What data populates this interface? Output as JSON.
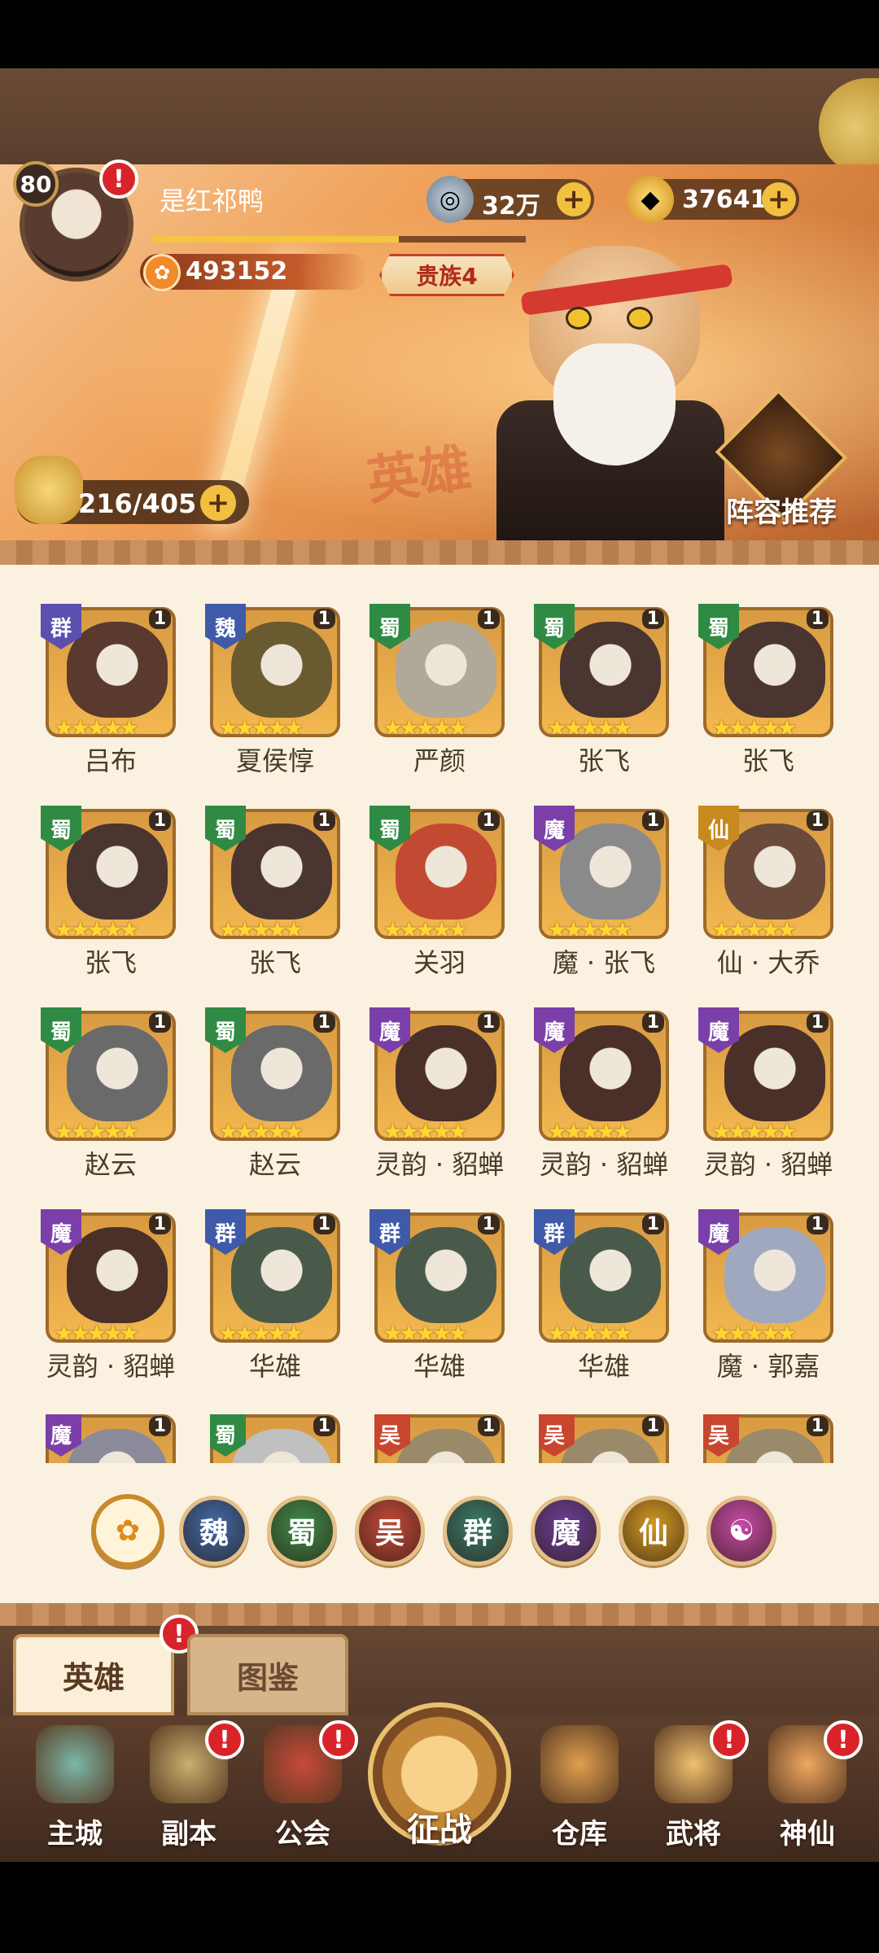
{
  "player": {
    "level": "80",
    "name": "是红祁鸭",
    "power": "493152",
    "vip": "贵族4",
    "exp_fraction": 0.66
  },
  "currencies": [
    {
      "name": "copper-coin",
      "value": "32万",
      "icon": "coin-icon"
    },
    {
      "name": "gold-ingot",
      "value": "37641",
      "icon": "ingot-icon"
    }
  ],
  "stamina": {
    "value": "216/405"
  },
  "banner": {
    "watermark": "英雄",
    "lineup_label": "阵容推荐"
  },
  "alert_glyph": "!",
  "plus_glyph": "+",
  "heroes": [
    {
      "faction": "群",
      "tier": "1",
      "name": "吕布",
      "color": "#5b4fb0"
    },
    {
      "faction": "魏",
      "tier": "1",
      "name": "夏侯惇",
      "color": "#3f5aa8"
    },
    {
      "faction": "蜀",
      "tier": "1",
      "name": "严颜",
      "color": "#2f8a44"
    },
    {
      "faction": "蜀",
      "tier": "1",
      "name": "张飞",
      "color": "#2f8a44"
    },
    {
      "faction": "蜀",
      "tier": "1",
      "name": "张飞",
      "color": "#2f8a44"
    },
    {
      "faction": "蜀",
      "tier": "1",
      "name": "张飞",
      "color": "#2f8a44"
    },
    {
      "faction": "蜀",
      "tier": "1",
      "name": "张飞",
      "color": "#2f8a44"
    },
    {
      "faction": "蜀",
      "tier": "1",
      "name": "关羽",
      "color": "#2f8a44"
    },
    {
      "faction": "魔",
      "tier": "1",
      "name": "魔 · 张飞",
      "color": "#7a3fa8"
    },
    {
      "faction": "仙",
      "tier": "1",
      "name": "仙 · 大乔",
      "color": "#c78a1e"
    },
    {
      "faction": "蜀",
      "tier": "1",
      "name": "赵云",
      "color": "#2f8a44"
    },
    {
      "faction": "蜀",
      "tier": "1",
      "name": "赵云",
      "color": "#2f8a44"
    },
    {
      "faction": "魔",
      "tier": "1",
      "name": "灵韵 · 貂蝉",
      "color": "#7a3fa8"
    },
    {
      "faction": "魔",
      "tier": "1",
      "name": "灵韵 · 貂蝉",
      "color": "#7a3fa8"
    },
    {
      "faction": "魔",
      "tier": "1",
      "name": "灵韵 · 貂蝉",
      "color": "#7a3fa8"
    },
    {
      "faction": "魔",
      "tier": "1",
      "name": "灵韵 · 貂蝉",
      "color": "#7a3fa8"
    },
    {
      "faction": "群",
      "tier": "1",
      "name": "华雄",
      "color": "#3f5aa8"
    },
    {
      "faction": "群",
      "tier": "1",
      "name": "华雄",
      "color": "#3f5aa8"
    },
    {
      "faction": "群",
      "tier": "1",
      "name": "华雄",
      "color": "#3f5aa8"
    },
    {
      "faction": "魔",
      "tier": "1",
      "name": "魔 · 郭嘉",
      "color": "#7a3fa8"
    },
    {
      "faction": "魔",
      "tier": "1",
      "name": "",
      "color": "#7a3fa8"
    },
    {
      "faction": "蜀",
      "tier": "1",
      "name": "",
      "color": "#2f8a44"
    },
    {
      "faction": "吴",
      "tier": "1",
      "name": "",
      "color": "#c8452e"
    },
    {
      "faction": "吴",
      "tier": "1",
      "name": "",
      "color": "#c8452e"
    },
    {
      "faction": "吴",
      "tier": "1",
      "name": "",
      "color": "#c8452e"
    }
  ],
  "filters": [
    {
      "label": "",
      "name": "all",
      "color": "#f2b33a",
      "icon": "paw-icon"
    },
    {
      "label": "魏",
      "name": "wei",
      "color": "#3f6aa8"
    },
    {
      "label": "蜀",
      "name": "shu",
      "color": "#3f8a4a"
    },
    {
      "label": "吴",
      "name": "wu",
      "color": "#c24a3a"
    },
    {
      "label": "群",
      "name": "qun",
      "color": "#3a7a6a"
    },
    {
      "label": "魔",
      "name": "mo",
      "color": "#6a3f98"
    },
    {
      "label": "仙",
      "name": "xian",
      "color": "#d29a24"
    },
    {
      "label": "",
      "name": "special",
      "color": "#c84aa8",
      "icon": "swirl-icon"
    }
  ],
  "tabs": [
    {
      "label": "英雄",
      "active": true
    },
    {
      "label": "图鉴",
      "active": false
    }
  ],
  "nav": [
    {
      "label": "主城",
      "alert": false
    },
    {
      "label": "副本",
      "alert": true
    },
    {
      "label": "公会",
      "alert": true
    },
    {
      "label": "征战",
      "alert": false
    },
    {
      "label": "仓库",
      "alert": false
    },
    {
      "label": "武将",
      "alert": true
    },
    {
      "label": "神仙",
      "alert": true
    }
  ]
}
